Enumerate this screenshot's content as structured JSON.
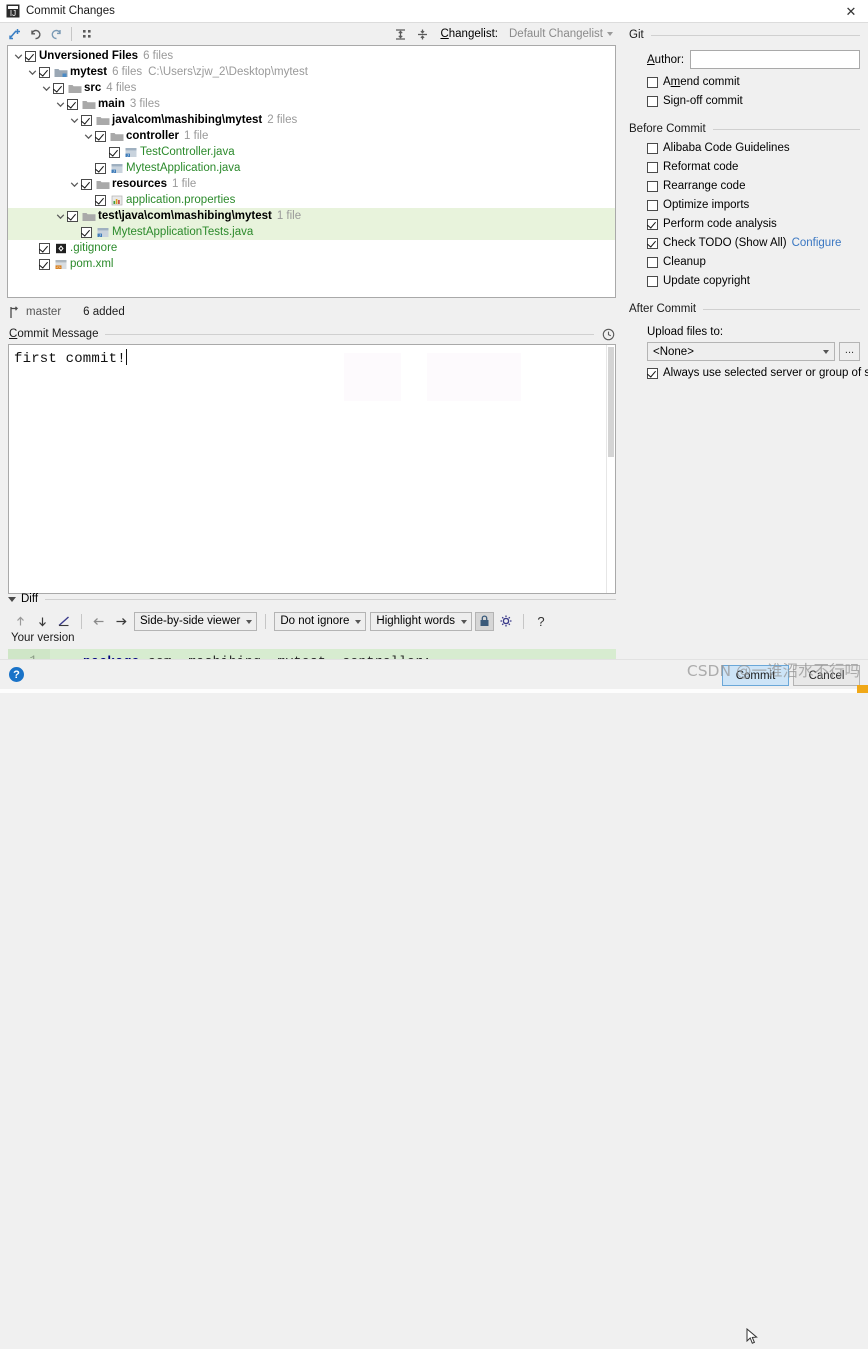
{
  "window": {
    "title": "Commit Changes",
    "app_icon": "intellij-icon",
    "close_label": "✕"
  },
  "toolbar": {
    "buttons": [
      {
        "name": "add-to-vcs-icon",
        "tooltip": "Add"
      },
      {
        "name": "rollback-icon",
        "tooltip": "Rollback"
      },
      {
        "name": "refresh-icon",
        "tooltip": "Refresh"
      },
      {
        "name": "group-by-icon",
        "tooltip": "Group By"
      }
    ],
    "expand_all_icon": "expand-all-icon",
    "collapse_all_icon": "collapse-all-icon",
    "changelist_label": "Changelist:",
    "changelist_label_mnemonic": "C",
    "changelist_value": "Default Changelist"
  },
  "tree": {
    "rows": [
      {
        "indent": 0,
        "twisty": "expanded",
        "checked": true,
        "icon": "none",
        "name": "Unversioned Files",
        "style": "bold",
        "count": "6 files",
        "path": "",
        "selected": false
      },
      {
        "indent": 1,
        "twisty": "expanded",
        "checked": true,
        "icon": "module-icon",
        "name": "mytest",
        "style": "bold",
        "count": "6 files",
        "path": "C:\\Users\\zjw_2\\Desktop\\mytest",
        "selected": false
      },
      {
        "indent": 2,
        "twisty": "expanded",
        "checked": true,
        "icon": "folder-icon",
        "name": "src",
        "style": "bold",
        "count": "4 files",
        "path": "",
        "selected": false
      },
      {
        "indent": 3,
        "twisty": "expanded",
        "checked": true,
        "icon": "folder-icon",
        "name": "main",
        "style": "bold",
        "count": "3 files",
        "path": "",
        "selected": false
      },
      {
        "indent": 4,
        "twisty": "expanded",
        "checked": true,
        "icon": "folder-icon",
        "name": "java\\com\\mashibing\\mytest",
        "style": "bold",
        "count": "2 files",
        "path": "",
        "selected": false
      },
      {
        "indent": 5,
        "twisty": "expanded",
        "checked": true,
        "icon": "folder-icon",
        "name": "controller",
        "style": "bold",
        "count": "1 file",
        "path": "",
        "selected": false
      },
      {
        "indent": 6,
        "twisty": "none",
        "checked": true,
        "icon": "java-class-icon",
        "name": "TestController.java",
        "style": "green",
        "count": "",
        "path": "",
        "selected": false
      },
      {
        "indent": 5,
        "twisty": "none",
        "checked": true,
        "icon": "java-class-icon",
        "name": "MytestApplication.java",
        "style": "green",
        "count": "",
        "path": "",
        "selected": false
      },
      {
        "indent": 4,
        "twisty": "expanded",
        "checked": true,
        "icon": "folder-icon",
        "name": "resources",
        "style": "bold",
        "count": "1 file",
        "path": "",
        "selected": false
      },
      {
        "indent": 5,
        "twisty": "none",
        "checked": true,
        "icon": "properties-icon",
        "name": "application.properties",
        "style": "green",
        "count": "",
        "path": "",
        "selected": false
      },
      {
        "indent": 3,
        "twisty": "expanded",
        "checked": true,
        "icon": "folder-icon",
        "name": "test\\java\\com\\mashibing\\mytest",
        "style": "bold",
        "count": "1 file",
        "path": "",
        "selected": true
      },
      {
        "indent": 4,
        "twisty": "none",
        "checked": true,
        "icon": "java-class-icon",
        "name": "MytestApplicationTests.java",
        "style": "green",
        "count": "",
        "path": "",
        "selected": true
      },
      {
        "indent": 1,
        "twisty": "none",
        "checked": true,
        "icon": "gitignore-icon",
        "name": ".gitignore",
        "style": "green",
        "count": "",
        "path": "",
        "selected": false
      },
      {
        "indent": 1,
        "twisty": "none",
        "checked": true,
        "icon": "xml-icon",
        "name": "pom.xml",
        "style": "green",
        "count": "",
        "path": "",
        "selected": false
      }
    ]
  },
  "branch_bar": {
    "icon": "branch-icon",
    "branch": "master",
    "status": "6 added"
  },
  "commit_message": {
    "label": "Commit Message",
    "label_mnemonic": "C",
    "history_icon": "clock-icon",
    "value": "first commit!"
  },
  "diff": {
    "section_label": "Diff",
    "buttons": [
      {
        "name": "previous-difference-icon",
        "glyph": "↑"
      },
      {
        "name": "next-difference-icon",
        "glyph": "↓"
      },
      {
        "name": "edit-source-icon",
        "glyph": "pencil"
      },
      {
        "name": "accept-left-icon",
        "glyph": "←"
      },
      {
        "name": "accept-right-icon",
        "glyph": "→"
      }
    ],
    "viewer_mode": "Side-by-side viewer",
    "whitespace_mode": "Do not ignore",
    "highlight_mode": "Highlight words",
    "lock_icon": "lock-icon",
    "settings_icon": "gear-icon",
    "help_glyph": "?",
    "version_label": "Your version",
    "lines": [
      {
        "number": "1",
        "keyword": "package",
        "rest": " com. mashibing. mytest. controller;"
      }
    ]
  },
  "git_section": {
    "title": "Git",
    "author_label": "Author:",
    "author_label_mnemonic": "A",
    "author_value": "",
    "checkboxes": [
      {
        "label_pre": "A",
        "label_mn": "m",
        "label_post": "end commit",
        "label": "Amend commit",
        "checked": false,
        "name": "amend-commit"
      },
      {
        "label_pre": "Si",
        "label_mn": "g",
        "label_post": "n-off commit",
        "label": "Sign-off commit",
        "checked": false,
        "name": "sign-off-commit"
      }
    ]
  },
  "before_commit": {
    "title": "Before Commit",
    "checkboxes": [
      {
        "label": "Alibaba Code Guidelines",
        "checked": false,
        "name": "alibaba-code-guidelines"
      },
      {
        "label": "Reformat code",
        "checked": false,
        "name": "reformat-code"
      },
      {
        "label": "Rearrange code",
        "checked": false,
        "name": "rearrange-code"
      },
      {
        "label": "Optimize imports",
        "checked": false,
        "name": "optimize-imports"
      },
      {
        "label": "Perform code analysis",
        "checked": true,
        "name": "perform-code-analysis"
      },
      {
        "label": "Check TODO (Show All)",
        "checked": true,
        "name": "check-todo",
        "link": "Configure"
      },
      {
        "label": "Cleanup",
        "checked": false,
        "name": "cleanup"
      },
      {
        "label": "Update copyright",
        "checked": false,
        "name": "update-copyright"
      }
    ]
  },
  "after_commit": {
    "title": "After Commit",
    "upload_label": "Upload files to:",
    "upload_value": "<None>",
    "browse_label": "...",
    "always_use_label": "Always use selected server or group of servers",
    "always_use_checked": true
  },
  "bottom": {
    "help_glyph": "?",
    "commit_label": "Commit",
    "cancel_label": "Cancel",
    "watermark": "CSDN @一谁沼水不行吗"
  },
  "colors": {
    "accent_blue": "#3a77c2",
    "unversioned_green": "#2b8a2b",
    "selection_green": "#e8f3dc",
    "diff_added": "#d7ecd0",
    "keyword_blue": "#000080",
    "help_blue": "#1a73c8"
  }
}
